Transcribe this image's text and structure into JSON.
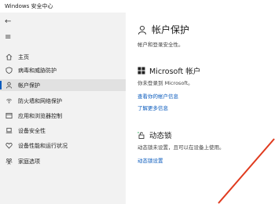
{
  "window": {
    "title": "Windows 安全中心"
  },
  "sidebar": {
    "items": [
      {
        "label": "主页",
        "icon": "home-icon"
      },
      {
        "label": "病毒和威胁防护",
        "icon": "shield-icon"
      },
      {
        "label": "帐户保护",
        "icon": "person-icon"
      },
      {
        "label": "防火墙和网络保护",
        "icon": "wifi-icon"
      },
      {
        "label": "应用和浏览器控制",
        "icon": "app-window-icon"
      },
      {
        "label": "设备安全性",
        "icon": "laptop-icon"
      },
      {
        "label": "设备性能和运行状况",
        "icon": "heart-icon"
      },
      {
        "label": "家庭选项",
        "icon": "family-icon"
      }
    ],
    "active_index": 2
  },
  "main": {
    "title": "帐户保护",
    "subtitle": "帐户和登录安全性。",
    "microsoft": {
      "heading": "Microsoft 帐户",
      "desc": "你未登录到 Microsoft。",
      "link1": "查看你的帐户信息",
      "link2": "了解更多信息"
    },
    "dynamic_lock": {
      "heading": "动态锁",
      "desc": "动态锁未设置，且可以在设备上使用。",
      "link": "动态锁设置"
    }
  },
  "colors": {
    "accent": "#0a5bbd",
    "sidebar_bg": "#f2f2f2",
    "annotation": "#e03a1e"
  }
}
